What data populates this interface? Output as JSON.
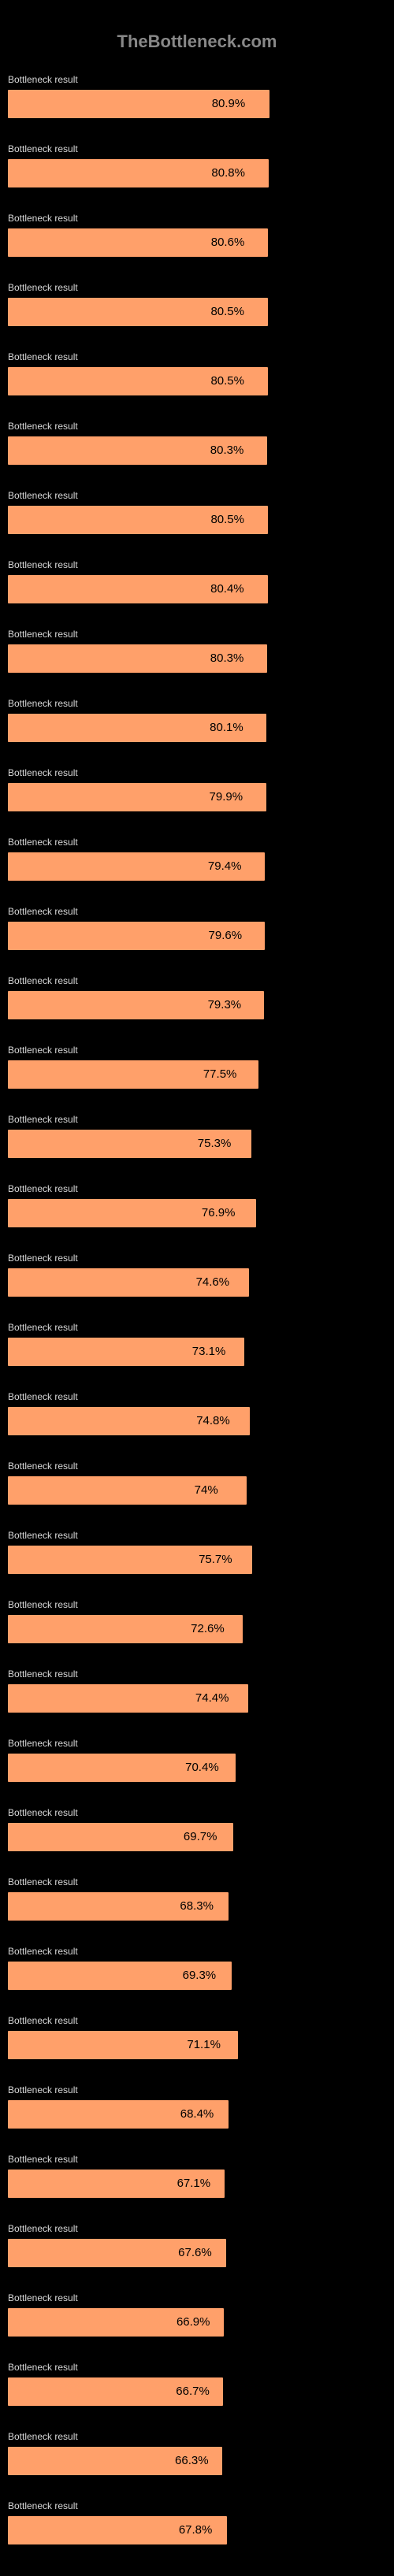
{
  "header": {
    "site": "TheBottleneck.com"
  },
  "chart_data": {
    "type": "bar",
    "title": "TheBottleneck.com",
    "xlabel": "",
    "ylabel": "",
    "ylim": [
      0,
      100
    ],
    "categories": [
      "Bottleneck result",
      "Bottleneck result",
      "Bottleneck result",
      "Bottleneck result",
      "Bottleneck result",
      "Bottleneck result",
      "Bottleneck result",
      "Bottleneck result",
      "Bottleneck result",
      "Bottleneck result",
      "Bottleneck result",
      "Bottleneck result",
      "Bottleneck result",
      "Bottleneck result",
      "Bottleneck result",
      "Bottleneck result",
      "Bottleneck result",
      "Bottleneck result",
      "Bottleneck result",
      "Bottleneck result",
      "Bottleneck result",
      "Bottleneck result",
      "Bottleneck result",
      "Bottleneck result",
      "Bottleneck result",
      "Bottleneck result",
      "Bottleneck result",
      "Bottleneck result",
      "Bottleneck result",
      "Bottleneck result",
      "Bottleneck result",
      "Bottleneck result",
      "Bottleneck result",
      "Bottleneck result",
      "Bottleneck result",
      "Bottleneck result"
    ],
    "values": [
      80.9,
      80.8,
      80.6,
      80.5,
      80.5,
      80.3,
      80.5,
      80.4,
      80.3,
      80.1,
      79.9,
      79.4,
      79.6,
      79.3,
      77.5,
      75.3,
      76.9,
      74.6,
      73.1,
      74.8,
      74.0,
      75.7,
      72.6,
      74.4,
      70.4,
      69.7,
      68.3,
      69.3,
      71.1,
      68.4,
      67.1,
      67.6,
      66.9,
      66.7,
      66.3,
      67.8
    ],
    "display_values": [
      "80.9%",
      "80.8%",
      "80.6%",
      "80.5%",
      "80.5%",
      "80.3%",
      "80.5%",
      "80.4%",
      "80.3%",
      "80.1%",
      "79.9%",
      "79.4%",
      "79.6%",
      "79.3%",
      "77.5%",
      "75.3%",
      "76.9%",
      "74.6%",
      "73.1%",
      "74.8%",
      "74%",
      "75.7%",
      "72.6%",
      "74.4%",
      "70.4%",
      "69.7%",
      "68.3%",
      "69.3%",
      "71.1%",
      "68.4%",
      "67.1%",
      "67.6%",
      "66.9%",
      "66.7%",
      "66.3%",
      "67.8%"
    ]
  }
}
